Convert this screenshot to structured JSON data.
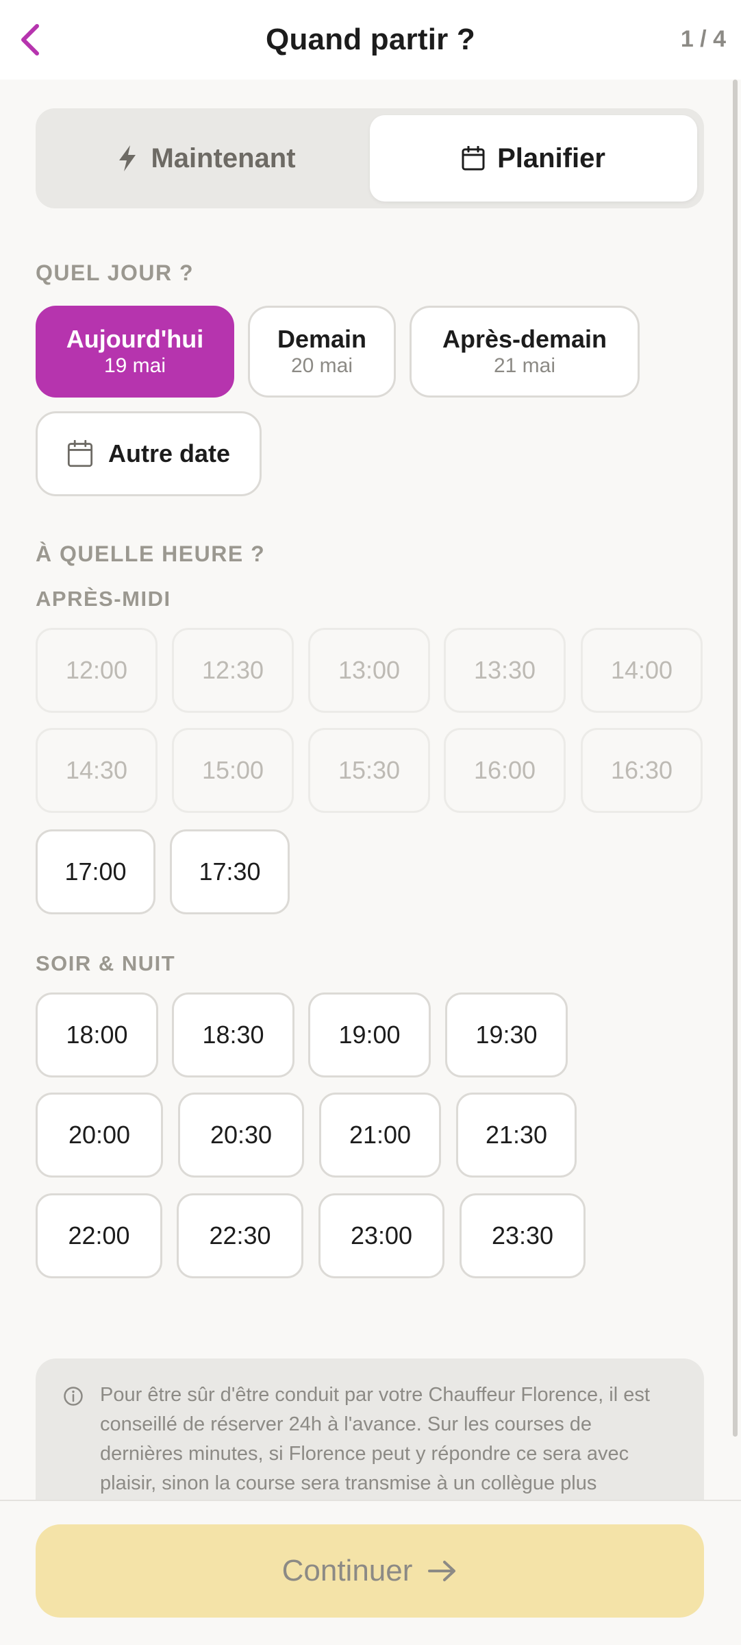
{
  "header": {
    "title": "Quand partir ?",
    "step": "1 / 4"
  },
  "mode_tabs": [
    {
      "label": "Maintenant",
      "icon": "lightning-icon",
      "active": false
    },
    {
      "label": "Planifier",
      "icon": "calendar-icon",
      "active": true
    }
  ],
  "day_section": {
    "label": "QUEL JOUR ?",
    "days": [
      {
        "label": "Aujourd'hui",
        "date": "19 mai",
        "selected": true
      },
      {
        "label": "Demain",
        "date": "20 mai",
        "selected": false
      },
      {
        "label": "Après-demain",
        "date": "21 mai",
        "selected": false
      }
    ],
    "other_date": "Autre date"
  },
  "time_section": {
    "label": "À QUELLE HEURE ?",
    "afternoon_label": "APRÈS-MIDI",
    "afternoon": [
      "12:00",
      "12:30",
      "13:00",
      "13:30",
      "14:00",
      "14:30",
      "15:00",
      "15:30",
      "16:00",
      "16:30",
      "17:00",
      "17:30"
    ],
    "afternoon_disabled": [
      "12:00",
      "12:30",
      "13:00",
      "13:30",
      "14:00",
      "14:30",
      "15:00",
      "15:30",
      "16:00",
      "16:30"
    ],
    "evening_label": "SOIR & NUIT",
    "evening": [
      "18:00",
      "18:30",
      "19:00",
      "19:30",
      "20:00",
      "20:30",
      "21:00",
      "21:30",
      "22:00",
      "22:30",
      "23:00",
      "23:30"
    ]
  },
  "info": {
    "text": "Pour être sûr d'être conduit par votre Chauffeur Florence, il est conseillé de réserver 24h à l'avance. Sur les courses de dernières minutes, si Florence peut y répondre ce sera avec plaisir, sinon la course sera transmise à un collègue plus"
  },
  "footer": {
    "continue_label": "Continuer"
  },
  "colors": {
    "accent": "#b634ae",
    "continue_bg": "#f4e3a8",
    "disabled_text": "#bdbab4"
  }
}
